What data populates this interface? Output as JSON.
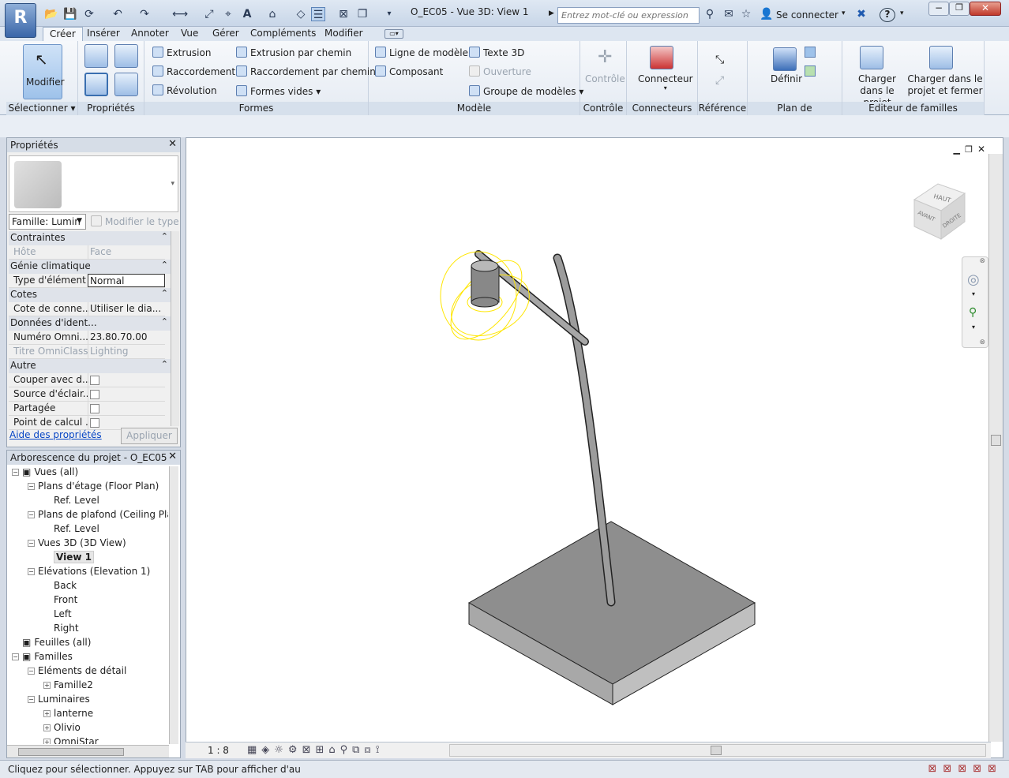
{
  "app": {
    "logo_letter": "R",
    "title": "O_EC05 - Vue 3D: View 1"
  },
  "search": {
    "placeholder": "Entrez mot-clé ou expression"
  },
  "header": {
    "signin": "Se connecter",
    "help": "?"
  },
  "tabs": [
    "Créer",
    "Insérer",
    "Annoter",
    "Vue",
    "Gérer",
    "Compléments",
    "Modifier"
  ],
  "ribbon": {
    "select": {
      "modify": "Modifier",
      "label": "Sélectionner"
    },
    "properties_label": "Propriétés",
    "forms": {
      "extrusion": "Extrusion",
      "blend": "Raccordement",
      "revolve": "Révolution",
      "sweep": "Extrusion par chemin",
      "swept_blend": "Raccordement par chemin",
      "void": "Formes vides",
      "label": "Formes"
    },
    "model": {
      "model_line": "Ligne de modèle",
      "component": "Composant",
      "text3d": "Texte 3D",
      "opening": "Ouverture",
      "model_group": "Groupe de modèles",
      "label": "Modèle"
    },
    "control": {
      "btn": "Contrôle",
      "label": "Contrôle"
    },
    "connectors": {
      "btn": "Connecteur",
      "label": "Connecteurs"
    },
    "reference": {
      "label": "Référence"
    },
    "workplane": {
      "btn": "Définir",
      "label": "Plan de construction"
    },
    "family_editor": {
      "load": "Charger dans le projet",
      "load_close": "Charger dans le projet et fermer",
      "label": "Editeur de familles"
    }
  },
  "props": {
    "title": "Propriétés",
    "family_select": "Famille: Lumin",
    "edit_type": "Modifier le type",
    "groups": [
      {
        "name": "Contraintes",
        "rows": [
          {
            "k": "Hôte",
            "v": "Face",
            "dim": true
          }
        ]
      },
      {
        "name": "Génie climatique",
        "rows": [
          {
            "k": "Type d'élément",
            "v": "Normal"
          }
        ]
      },
      {
        "name": "Cotes",
        "rows": [
          {
            "k": "Cote de conne...",
            "v": "Utiliser le dia..."
          }
        ]
      },
      {
        "name": "Données d'ident...",
        "rows": [
          {
            "k": "Numéro Omni...",
            "v": "23.80.70.00"
          },
          {
            "k": "Titre OmniClass",
            "v": "Lighting",
            "dim": true
          }
        ]
      },
      {
        "name": "Autre",
        "rows": [
          {
            "k": "Couper avec d...",
            "v": ""
          },
          {
            "k": "Source d'éclair...",
            "v": ""
          },
          {
            "k": "Partagée",
            "v": ""
          },
          {
            "k": "Point de calcul ...",
            "v": ""
          }
        ]
      }
    ],
    "help_link": "Aide des propriétés",
    "apply": "Appliquer"
  },
  "tree": {
    "title": "Arborescence du projet - O_EC05",
    "nodes": [
      {
        "label": "Vues (all)",
        "level": 0,
        "exp": "-"
      },
      {
        "label": "Plans d'étage (Floor Plan)",
        "level": 1,
        "exp": "-"
      },
      {
        "label": "Ref. Level",
        "level": 2,
        "exp": ""
      },
      {
        "label": "Plans de plafond (Ceiling Plan",
        "level": 1,
        "exp": "-"
      },
      {
        "label": "Ref. Level",
        "level": 2,
        "exp": ""
      },
      {
        "label": "Vues 3D (3D View)",
        "level": 1,
        "exp": "-"
      },
      {
        "label": "View 1",
        "level": 2,
        "exp": "",
        "bold": true
      },
      {
        "label": "Elévations (Elevation 1)",
        "level": 1,
        "exp": "-"
      },
      {
        "label": "Back",
        "level": 2,
        "exp": ""
      },
      {
        "label": "Front",
        "level": 2,
        "exp": ""
      },
      {
        "label": "Left",
        "level": 2,
        "exp": ""
      },
      {
        "label": "Right",
        "level": 2,
        "exp": ""
      },
      {
        "label": "Feuilles (all)",
        "level": 0,
        "exp": ""
      },
      {
        "label": "Familles",
        "level": 0,
        "exp": "-"
      },
      {
        "label": "Eléments de détail",
        "level": 1,
        "exp": "-"
      },
      {
        "label": "Famille2",
        "level": 2,
        "exp": "+"
      },
      {
        "label": "Luminaires",
        "level": 1,
        "exp": "-"
      },
      {
        "label": "lanterne",
        "level": 2,
        "exp": "+"
      },
      {
        "label": "Olivio",
        "level": 2,
        "exp": "+"
      },
      {
        "label": "OmniStar",
        "level": 2,
        "exp": "+"
      }
    ]
  },
  "viewcube": {
    "top": "HAUT",
    "front": "AVANT",
    "right": "DROITE"
  },
  "view": {
    "scale": "1 : 8"
  },
  "status": {
    "text": "Cliquez pour sélectionner. Appuyez sur TAB pour afficher d'au"
  },
  "colors": {
    "selection": "#ffe600",
    "model_fill": "#a0a0a0"
  }
}
